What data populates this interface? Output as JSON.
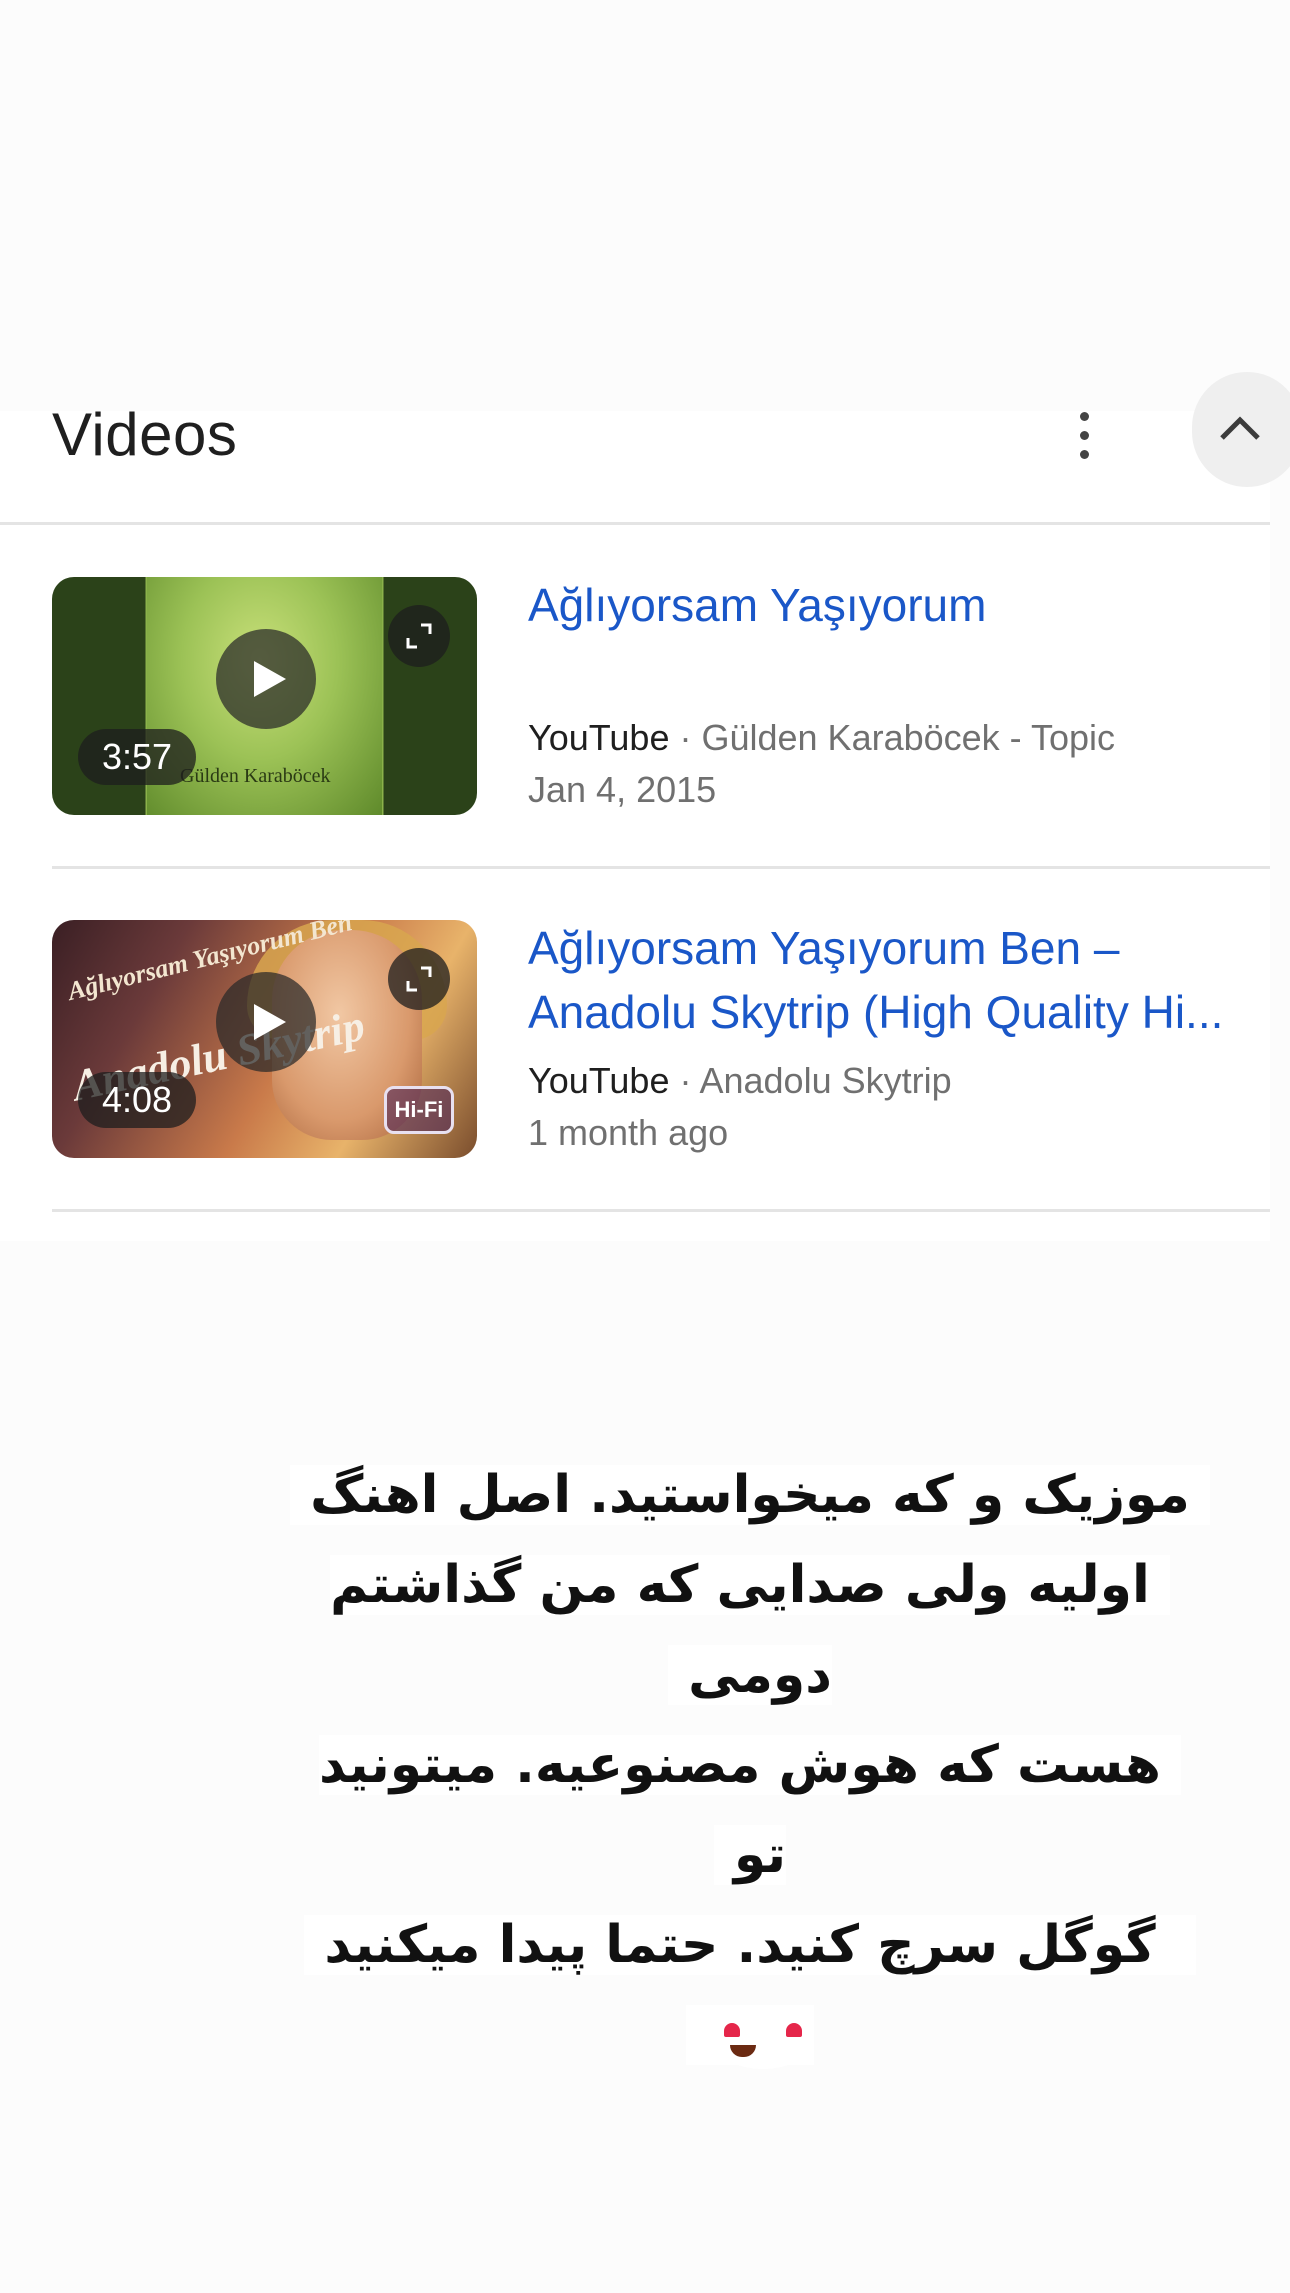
{
  "section": {
    "title": "Videos"
  },
  "videos": [
    {
      "title": "Ağlıyorsam Yaşıyorum",
      "title_line2": "",
      "source": "YouTube",
      "separator": " · ",
      "channel": "Gülden Karaböcek - Topic",
      "date": "Jan 4, 2015",
      "duration": "3:57",
      "thumb_caption": "Gülden Karaböcek"
    },
    {
      "title": "Ağlıyorsam Yaşıyorum Ben –",
      "title_line2": "Anadolu Skytrip (High Quality Hi...",
      "source": "YouTube",
      "separator": " · ",
      "channel": "Anadolu Skytrip",
      "date": "1 month ago",
      "duration": "4:08",
      "thumb_text1": "Ağlıyorsam Yaşıyorum Ben",
      "thumb_text2": "Anadolu Skytrip",
      "thumb_badge": "Hi-Fi"
    }
  ],
  "overlay_note": {
    "lines": [
      "موزیک و که میخواستید. اصل اهنگ",
      "اولیه ولی صدایی که من گذاشتم دومی",
      "هست که هوش مصنوعیه. میتونید تو",
      "گوگل سرچ کنید. حتما پیدا میکنید"
    ],
    "emoji": "heart-eyes-emoji"
  },
  "icons": {
    "menu": "more-vert-icon",
    "collapse": "chevron-up-icon",
    "play": "play-icon",
    "expand": "expand-icon"
  }
}
